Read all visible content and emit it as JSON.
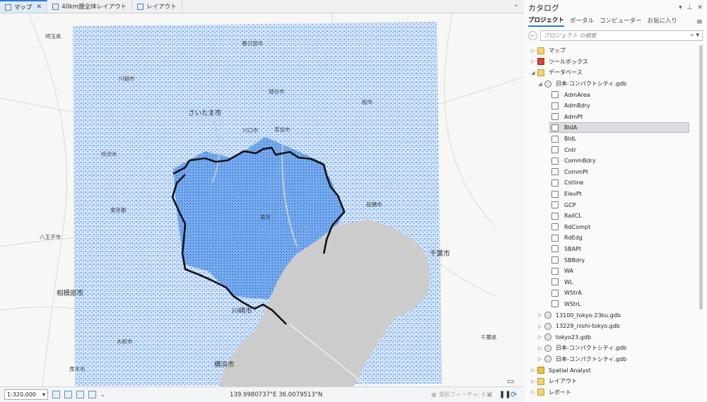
{
  "tabs": [
    {
      "label": "マップ",
      "active": true,
      "closable": true
    },
    {
      "label": "40km圏全体レイアウト",
      "active": false
    },
    {
      "label": "レイアウト",
      "active": false
    }
  ],
  "map": {
    "labels": {
      "saitama_ken": "埼玉県",
      "kasukabe": "春日部市",
      "kawagoe": "川越市",
      "koshigaya": "越谷市",
      "kashiwa": "柏市",
      "saitama": "さいたま市",
      "kawaguchi": "川口市",
      "soka": "草加市",
      "tokorozawa": "所沢市",
      "funabashi": "船橋市",
      "tokyo_to": "東京都",
      "tokyo_chu": "東京",
      "hachioji": "八王子市",
      "chiba": "千葉市",
      "sagamihara": "相模原市",
      "kawasaki": "川崎市",
      "chiba_ken": "千葉県",
      "yamato": "大和市",
      "atsugi": "厚木市",
      "yokohama": "横浜市"
    },
    "colors": {
      "land": "#f7f7f6",
      "buildings": "#6fa8ee",
      "water": "#cccccc",
      "boundary": "#111111"
    }
  },
  "status": {
    "scale": "1:320,000",
    "coordinates": "139.9980737°E 36.0079513°N",
    "selected_features": "選択フィーチャ: 0"
  },
  "catalog": {
    "title": "カタログ",
    "tabs": [
      "プロジェクト",
      "ポータル",
      "コンピューター",
      "お気に入り"
    ],
    "search_placeholder": "プロジェクト の検索",
    "tree": [
      {
        "label": "マップ",
        "indent": 0,
        "caret": "▷",
        "icon": "folder"
      },
      {
        "label": "ツールボックス",
        "indent": 0,
        "caret": "▷",
        "icon": "toolbox"
      },
      {
        "label": "データベース",
        "indent": 0,
        "caret": "◢",
        "icon": "folder"
      },
      {
        "label": "日本-コンパクトシティ.gdb",
        "indent": 1,
        "caret": "◢",
        "icon": "gdb"
      },
      {
        "label": "AdmArea",
        "indent": 2,
        "icon": "fc"
      },
      {
        "label": "AdmBdry",
        "indent": 2,
        "icon": "fc"
      },
      {
        "label": "AdmPt",
        "indent": 2,
        "icon": "fc"
      },
      {
        "label": "BldA",
        "indent": 2,
        "icon": "fc",
        "selected": true
      },
      {
        "label": "BldL",
        "indent": 2,
        "icon": "fc"
      },
      {
        "label": "Cntr",
        "indent": 2,
        "icon": "fc"
      },
      {
        "label": "CommBdry",
        "indent": 2,
        "icon": "fc"
      },
      {
        "label": "CommPt",
        "indent": 2,
        "icon": "fc"
      },
      {
        "label": "Cstline",
        "indent": 2,
        "icon": "fc"
      },
      {
        "label": "ElevPt",
        "indent": 2,
        "icon": "fc"
      },
      {
        "label": "GCP",
        "indent": 2,
        "icon": "fc"
      },
      {
        "label": "RailCL",
        "indent": 2,
        "icon": "fc"
      },
      {
        "label": "RdCompt",
        "indent": 2,
        "icon": "fc"
      },
      {
        "label": "RdEdg",
        "indent": 2,
        "icon": "fc"
      },
      {
        "label": "SBAPt",
        "indent": 2,
        "icon": "fc"
      },
      {
        "label": "SBBdry",
        "indent": 2,
        "icon": "fc"
      },
      {
        "label": "WA",
        "indent": 2,
        "icon": "fc"
      },
      {
        "label": "WL",
        "indent": 2,
        "icon": "fc"
      },
      {
        "label": "WStrA",
        "indent": 2,
        "icon": "fc"
      },
      {
        "label": "WStrL",
        "indent": 2,
        "icon": "fc"
      },
      {
        "label": "13100_tokyo-23ku.gdb",
        "indent": 1,
        "caret": "▷",
        "icon": "gdb"
      },
      {
        "label": "13229_nishi-tokyo.gdb",
        "indent": 1,
        "caret": "▷",
        "icon": "gdb"
      },
      {
        "label": "tokyo23.gdb",
        "indent": 1,
        "caret": "▷",
        "icon": "gdb"
      },
      {
        "label": "日本-コンパクトシティ.gdb",
        "indent": 1,
        "caret": "▷",
        "icon": "gdb"
      },
      {
        "label": "日本-コンパクトシティ.gdb",
        "indent": 1,
        "caret": "▷",
        "icon": "gdb"
      },
      {
        "label": "Spatial Analyst",
        "indent": 0,
        "caret": "▷",
        "icon": "analyst"
      },
      {
        "label": "レイアウト",
        "indent": 0,
        "caret": "▷",
        "icon": "folder"
      },
      {
        "label": "レポート",
        "indent": 0,
        "caret": "▷",
        "icon": "folder"
      }
    ]
  }
}
